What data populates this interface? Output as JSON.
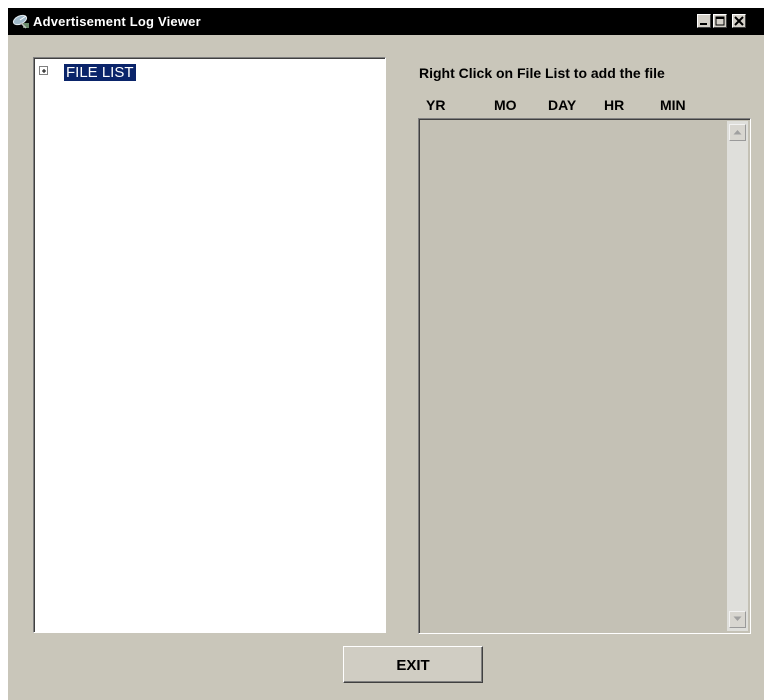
{
  "window": {
    "title": "Advertisement Log Viewer",
    "icon": "satellite-dish-icon"
  },
  "tree": {
    "root_label": "FILE LIST",
    "expander": "plus"
  },
  "instruction": "Right Click on File List to add the file",
  "columns": [
    "YR",
    "MO",
    "DAY",
    "HR",
    "MIN"
  ],
  "exit_label": "EXIT",
  "colors": {
    "titlebar": "#000000",
    "window_bg": "#c9c6ba",
    "selection": "#0a246a"
  }
}
